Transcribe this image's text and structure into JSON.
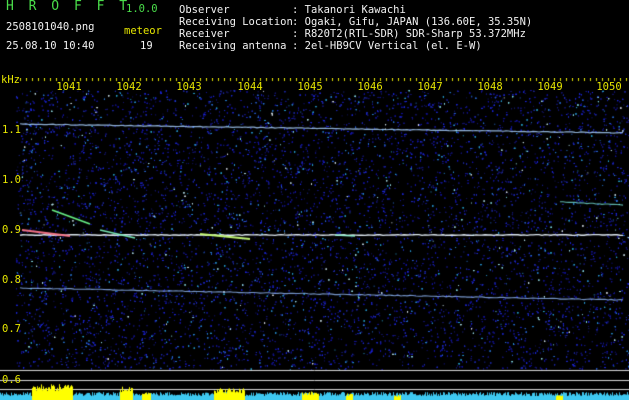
{
  "app": {
    "name": "H R O F F T",
    "version": "1.0.0"
  },
  "file_name": "2508101040.png",
  "datetime": "25.08.10 10:40",
  "meteor": {
    "label": "meteor",
    "count": "19"
  },
  "info": [
    {
      "key": "Observer",
      "value": ": Takanori Kawachi"
    },
    {
      "key": "Receiving Location",
      "value": ": Ogaki, Gifu, JAPAN (136.60E, 35.35N)"
    },
    {
      "key": "Receiver",
      "value": ": R820T2(RTL-SDR) SDR-Sharp 53.372MHz"
    },
    {
      "key": "Receiving antenna",
      "value": ": 2el-HB9CV Vertical (el. E-W)"
    }
  ],
  "y_unit": "kHz",
  "x_ticks": [
    "1041",
    "1042",
    "1043",
    "1044",
    "1045",
    "1046",
    "1047",
    "1048",
    "1049",
    "1050"
  ],
  "y_ticks": [
    "1.1",
    "1.0",
    "0.9",
    "0.8",
    "0.7",
    "0.6"
  ],
  "colors": {
    "background": "#000000",
    "noise": "#1a1a8c",
    "signal": "#e8f4ff",
    "echo": "#4ade80",
    "level": "#ffff00",
    "base": "#3ec8f0"
  }
}
